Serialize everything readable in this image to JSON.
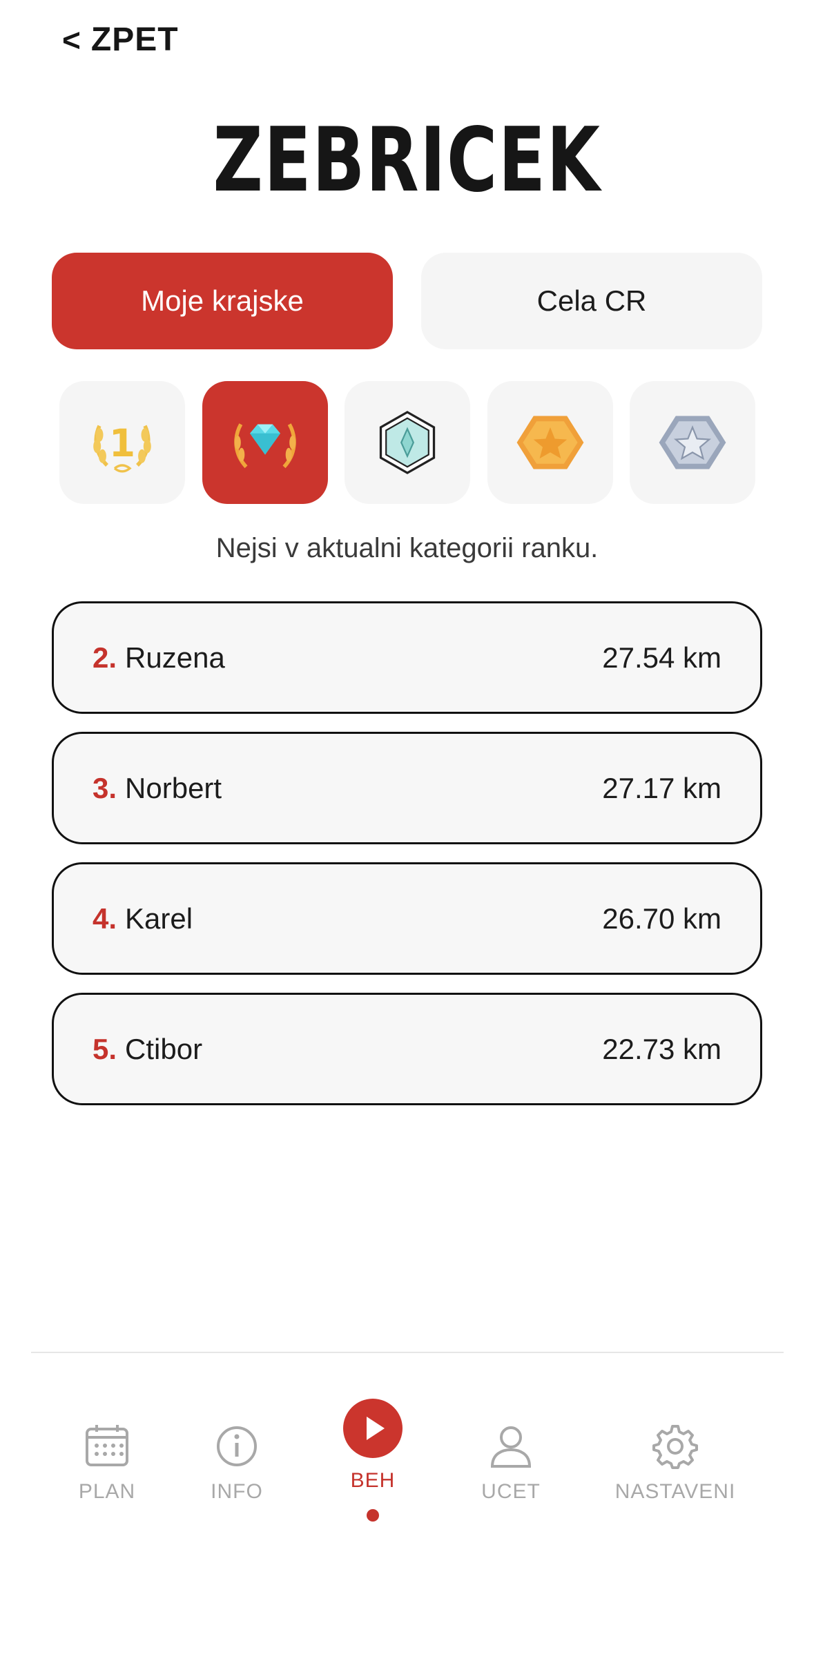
{
  "header": {
    "back_label": "ZPET",
    "title": "ZEBRICEK"
  },
  "segments": {
    "left": "Moje krajske",
    "right": "Cela CR"
  },
  "ranks": [
    {
      "icon": "gold-laurel-first-place-icon",
      "active": false
    },
    {
      "icon": "diamond-laurel-icon",
      "active": true
    },
    {
      "icon": "crystal-hexagon-badge-icon",
      "active": false
    },
    {
      "icon": "gold-star-hexagon-badge-icon",
      "active": false
    },
    {
      "icon": "silver-star-hexagon-badge-icon",
      "active": false
    }
  ],
  "notice": "Nejsi v aktualni kategorii ranku.",
  "leaderboard": [
    {
      "pos": "2.",
      "name": "Ruzena",
      "distance": "27.54 km"
    },
    {
      "pos": "3.",
      "name": "Norbert",
      "distance": "27.17 km"
    },
    {
      "pos": "4.",
      "name": "Karel",
      "distance": "26.70 km"
    },
    {
      "pos": "5.",
      "name": "Ctibor",
      "distance": "22.73 km"
    }
  ],
  "nav": {
    "plan": "PLAN",
    "info": "INFO",
    "beh": "BEH",
    "ucet": "UCET",
    "nastaveni": "NASTAVENI"
  },
  "colors": {
    "accent": "#cb352d",
    "inactive": "#a8a8a8",
    "tile_bg": "#f5f5f5"
  }
}
